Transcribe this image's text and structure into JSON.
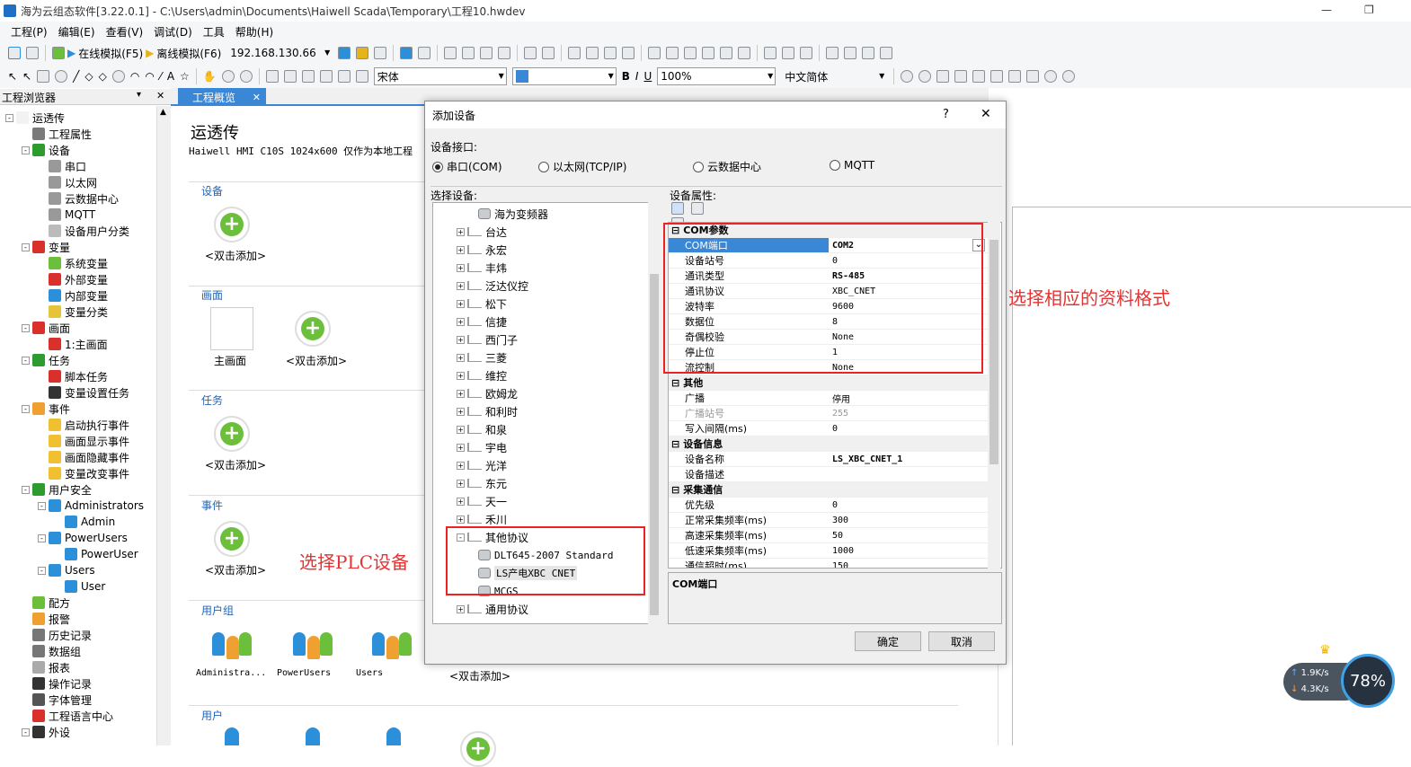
{
  "window": {
    "title": "海为云组态软件[3.22.0.1] - C:\\Users\\admin\\Documents\\Haiwell Scada\\Temporary\\工程10.hwdev",
    "min": "—",
    "max": "❐"
  },
  "menu": [
    "工程(P)",
    "编辑(E)",
    "查看(V)",
    "调试(D)",
    "工具",
    "帮助(H)"
  ],
  "toolbar": {
    "online_sim": "在线模拟(F5)",
    "offline_sim": "离线模拟(F6)",
    "ip": "192.168.130.66",
    "font": "宋体",
    "zoom": "100%",
    "lang": "中文简体"
  },
  "explorer": {
    "title": "工程浏览器",
    "close": "✕"
  },
  "tree": [
    {
      "label": "运透传",
      "lvl": 0,
      "ex": "-",
      "color": "#f2f2f2"
    },
    {
      "label": "工程属性",
      "lvl": 1,
      "color": "#7a7a7a"
    },
    {
      "label": "设备",
      "lvl": 1,
      "ex": "-",
      "color": "#2d9b2d"
    },
    {
      "label": "串口",
      "lvl": 2,
      "color": "#999"
    },
    {
      "label": "以太网",
      "lvl": 2,
      "color": "#999"
    },
    {
      "label": "云数据中心",
      "lvl": 2,
      "color": "#999"
    },
    {
      "label": "MQTT",
      "lvl": 2,
      "color": "#999"
    },
    {
      "label": "设备用户分类",
      "lvl": 2,
      "color": "#bbb"
    },
    {
      "label": "变量",
      "lvl": 1,
      "ex": "-",
      "color": "#d9302b"
    },
    {
      "label": "系统变量",
      "lvl": 2,
      "color": "#6cbf3b"
    },
    {
      "label": "外部变量",
      "lvl": 2,
      "color": "#d9302b"
    },
    {
      "label": "内部变量",
      "lvl": 2,
      "color": "#2b8fd9"
    },
    {
      "label": "变量分类",
      "lvl": 2,
      "color": "#e7c33a"
    },
    {
      "label": "画面",
      "lvl": 1,
      "ex": "-",
      "color": "#d9302b"
    },
    {
      "label": "1:主画面",
      "lvl": 2,
      "color": "#d9302b"
    },
    {
      "label": "任务",
      "lvl": 1,
      "ex": "-",
      "color": "#2d9b2d"
    },
    {
      "label": "脚本任务",
      "lvl": 2,
      "color": "#d9302b"
    },
    {
      "label": "变量设置任务",
      "lvl": 2,
      "color": "#333"
    },
    {
      "label": "事件",
      "lvl": 1,
      "ex": "-",
      "color": "#f0a030"
    },
    {
      "label": "启动执行事件",
      "lvl": 2,
      "color": "#f0c030"
    },
    {
      "label": "画面显示事件",
      "lvl": 2,
      "color": "#f0c030"
    },
    {
      "label": "画面隐藏事件",
      "lvl": 2,
      "color": "#f0c030"
    },
    {
      "label": "变量改变事件",
      "lvl": 2,
      "color": "#f0c030"
    },
    {
      "label": "用户安全",
      "lvl": 1,
      "ex": "-",
      "color": "#2d9b2d"
    },
    {
      "label": "Administrators",
      "lvl": 2,
      "ex": "-",
      "color": "#2b8fd9"
    },
    {
      "label": "Admin",
      "lvl": 3,
      "color": "#2b8fd9"
    },
    {
      "label": "PowerUsers",
      "lvl": 2,
      "ex": "-",
      "color": "#2b8fd9"
    },
    {
      "label": "PowerUser",
      "lvl": 3,
      "color": "#2b8fd9"
    },
    {
      "label": "Users",
      "lvl": 2,
      "ex": "-",
      "color": "#2b8fd9"
    },
    {
      "label": "User",
      "lvl": 3,
      "color": "#2b8fd9"
    },
    {
      "label": "配方",
      "lvl": 1,
      "color": "#6cbf3b"
    },
    {
      "label": "报警",
      "lvl": 1,
      "color": "#f0a030"
    },
    {
      "label": "历史记录",
      "lvl": 1,
      "color": "#777"
    },
    {
      "label": "数据组",
      "lvl": 1,
      "color": "#777"
    },
    {
      "label": "报表",
      "lvl": 1,
      "color": "#aaa"
    },
    {
      "label": "操作记录",
      "lvl": 1,
      "color": "#333"
    },
    {
      "label": "字体管理",
      "lvl": 1,
      "color": "#555"
    },
    {
      "label": "工程语言中心",
      "lvl": 1,
      "color": "#d9302b"
    },
    {
      "label": "外设",
      "lvl": 1,
      "ex": "-",
      "color": "#333"
    }
  ],
  "tab": {
    "label": "工程概览",
    "close": "✕"
  },
  "overview": {
    "project": "运透传",
    "info": "Haiwell HMI C10S   1024x600   仅作为本地工程",
    "sections": {
      "device": "设备",
      "screen": "画面",
      "task": "任务",
      "event": "事件",
      "usergroup": "用户组",
      "user": "用户"
    },
    "add_label": "<双击添加>",
    "main_screen": "主画面",
    "groups": [
      "Administra...",
      "PowerUsers",
      "Users"
    ]
  },
  "annotations": {
    "plc": "选择PLC设备",
    "format": "选择相应的资料格式"
  },
  "dialog": {
    "title": "添加设备",
    "help": "?",
    "close": "✕",
    "iface_label": "设备接口:",
    "ifaces": [
      "串口(COM)",
      "以太网(TCP/IP)",
      "云数据中心",
      "MQTT"
    ],
    "select_label": "选择设备:",
    "props_label": "设备属性:",
    "ok": "确定",
    "cancel": "取消",
    "desc": "COM端口"
  },
  "devices": [
    {
      "label": "海为变频器",
      "lvl": 2,
      "type": "db"
    },
    {
      "label": "台达",
      "lvl": 1,
      "ex": "+"
    },
    {
      "label": "永宏",
      "lvl": 1,
      "ex": "+"
    },
    {
      "label": "丰炜",
      "lvl": 1,
      "ex": "+"
    },
    {
      "label": "泛达仪控",
      "lvl": 1,
      "ex": "+"
    },
    {
      "label": "松下",
      "lvl": 1,
      "ex": "+"
    },
    {
      "label": "信捷",
      "lvl": 1,
      "ex": "+"
    },
    {
      "label": "西门子",
      "lvl": 1,
      "ex": "+"
    },
    {
      "label": "三菱",
      "lvl": 1,
      "ex": "+"
    },
    {
      "label": "维控",
      "lvl": 1,
      "ex": "+"
    },
    {
      "label": "欧姆龙",
      "lvl": 1,
      "ex": "+"
    },
    {
      "label": "和利时",
      "lvl": 1,
      "ex": "+"
    },
    {
      "label": "和泉",
      "lvl": 1,
      "ex": "+"
    },
    {
      "label": "宇电",
      "lvl": 1,
      "ex": "+"
    },
    {
      "label": "光洋",
      "lvl": 1,
      "ex": "+"
    },
    {
      "label": "东元",
      "lvl": 1,
      "ex": "+"
    },
    {
      "label": "天一",
      "lvl": 1,
      "ex": "+"
    },
    {
      "label": "禾川",
      "lvl": 1,
      "ex": "+"
    },
    {
      "label": "其他协议",
      "lvl": 1,
      "ex": "-"
    },
    {
      "label": "DLT645-2007 Standard",
      "lvl": 2,
      "type": "db"
    },
    {
      "label": "LS产电XBC CNET",
      "lvl": 2,
      "type": "db",
      "selected": true
    },
    {
      "label": "MCGS",
      "lvl": 2,
      "type": "db"
    },
    {
      "label": "通用协议",
      "lvl": 1,
      "ex": "+"
    }
  ],
  "props": [
    {
      "k": "COM参数",
      "grp": true
    },
    {
      "k": "COM端口",
      "v": "COM2",
      "sel": true
    },
    {
      "k": "设备站号",
      "v": "0"
    },
    {
      "k": "通讯类型",
      "v": "RS-485",
      "b": true
    },
    {
      "k": "通讯协议",
      "v": "XBC_CNET"
    },
    {
      "k": "波特率",
      "v": "9600"
    },
    {
      "k": "数据位",
      "v": "8"
    },
    {
      "k": "奇偶校验",
      "v": "None"
    },
    {
      "k": "停止位",
      "v": "1"
    },
    {
      "k": "流控制",
      "v": "None"
    },
    {
      "k": "其他",
      "grp": true
    },
    {
      "k": "广播",
      "v": "停用"
    },
    {
      "k": "广播站号",
      "v": "255",
      "dim": true
    },
    {
      "k": "写入间隔(ms)",
      "v": "0"
    },
    {
      "k": "设备信息",
      "grp": true
    },
    {
      "k": "设备名称",
      "v": "LS_XBC_CNET_1",
      "b": true
    },
    {
      "k": "设备描述",
      "v": ""
    },
    {
      "k": "采集通信",
      "grp": true
    },
    {
      "k": "优先级",
      "v": "0"
    },
    {
      "k": "正常采集频率(ms)",
      "v": "300"
    },
    {
      "k": "高速采集频率(ms)",
      "v": "50"
    },
    {
      "k": "低速采集频率(ms)",
      "v": "1000"
    },
    {
      "k": "通信超时(ms)",
      "v": "150"
    }
  ],
  "netmon": {
    "up": "1.9K/s",
    "down": "4.3K/s",
    "pct": "78%"
  }
}
